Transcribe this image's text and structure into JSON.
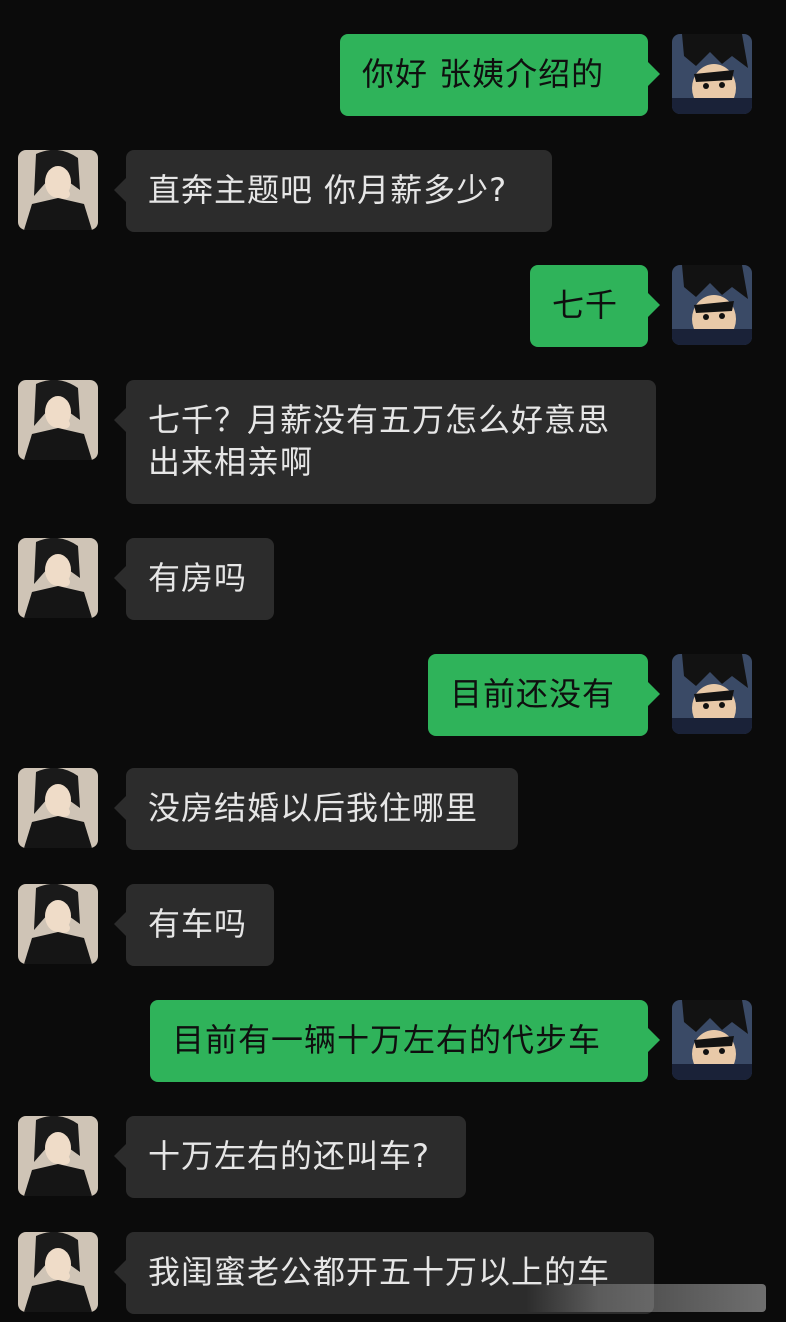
{
  "messages": [
    {
      "side": "out",
      "text": "你好  张姨介绍的"
    },
    {
      "side": "in",
      "text": "直奔主题吧  你月薪多少?"
    },
    {
      "side": "out",
      "text": "七千"
    },
    {
      "side": "in",
      "text": "七千？月薪没有五万怎么好意思出来相亲啊"
    },
    {
      "side": "in",
      "text": "有房吗"
    },
    {
      "side": "out",
      "text": "目前还没有"
    },
    {
      "side": "in",
      "text": "没房结婚以后我住哪里"
    },
    {
      "side": "in",
      "text": "有车吗"
    },
    {
      "side": "out",
      "text": "目前有一辆十万左右的代步车"
    },
    {
      "side": "in",
      "text": "十万左右的还叫车?"
    },
    {
      "side": "in",
      "text": "我闺蜜老公都开五十万以上的车"
    }
  ],
  "colors": {
    "background": "#0b0b0b",
    "incoming_bubble": "#2c2c2c",
    "outgoing_bubble": "#2fb35a"
  },
  "avatars": {
    "incoming": "woman-portrait-avatar",
    "outgoing": "anime-boy-avatar"
  }
}
